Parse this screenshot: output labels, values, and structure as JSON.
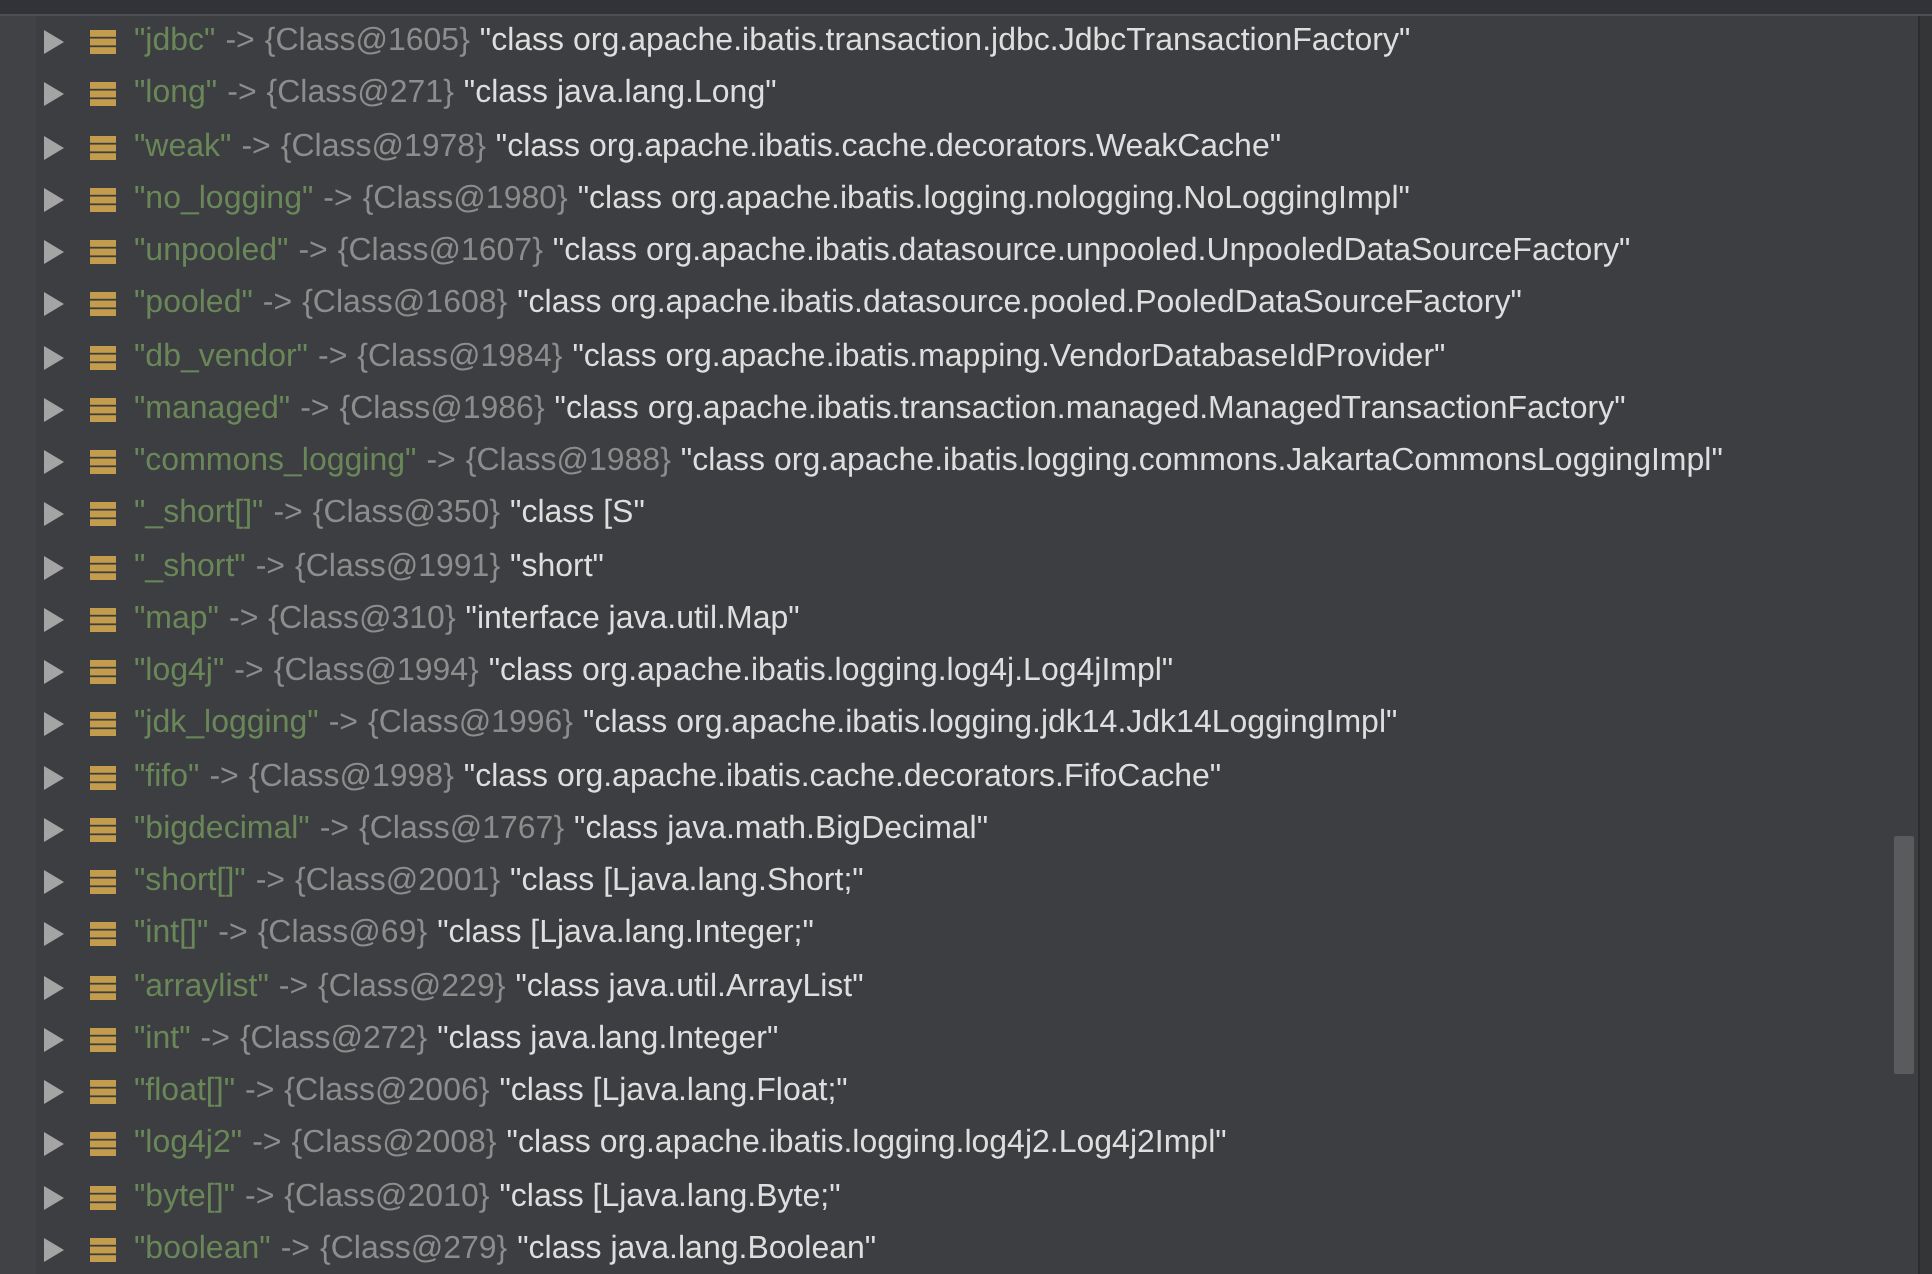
{
  "variables": [
    {
      "key": "\"jdbc\"",
      "arrow": "->",
      "ref": "{Class@1605}",
      "value": "\"class org.apache.ibatis.transaction.jdbc.JdbcTransactionFactory\"",
      "expanded": false
    },
    {
      "key": "\"long\"",
      "arrow": "->",
      "ref": "{Class@271}",
      "value": "\"class java.lang.Long\"",
      "expanded": false
    },
    {
      "key": "\"weak\"",
      "arrow": "->",
      "ref": "{Class@1978}",
      "value": "\"class org.apache.ibatis.cache.decorators.WeakCache\"",
      "expanded": false
    },
    {
      "key": "\"no_logging\"",
      "arrow": "->",
      "ref": "{Class@1980}",
      "value": "\"class org.apache.ibatis.logging.nologging.NoLoggingImpl\"",
      "expanded": false
    },
    {
      "key": "\"unpooled\"",
      "arrow": "->",
      "ref": "{Class@1607}",
      "value": "\"class org.apache.ibatis.datasource.unpooled.UnpooledDataSourceFactory\"",
      "expanded": false
    },
    {
      "key": "\"pooled\"",
      "arrow": "->",
      "ref": "{Class@1608}",
      "value": "\"class org.apache.ibatis.datasource.pooled.PooledDataSourceFactory\"",
      "expanded": false
    },
    {
      "key": "\"db_vendor\"",
      "arrow": "->",
      "ref": "{Class@1984}",
      "value": "\"class org.apache.ibatis.mapping.VendorDatabaseIdProvider\"",
      "expanded": false
    },
    {
      "key": "\"managed\"",
      "arrow": "->",
      "ref": "{Class@1986}",
      "value": "\"class org.apache.ibatis.transaction.managed.ManagedTransactionFactory\"",
      "expanded": false
    },
    {
      "key": "\"commons_logging\"",
      "arrow": "->",
      "ref": "{Class@1988}",
      "value": "\"class org.apache.ibatis.logging.commons.JakartaCommonsLoggingImpl\"",
      "expanded": false
    },
    {
      "key": "\"_short[]\"",
      "arrow": "->",
      "ref": "{Class@350}",
      "value": "\"class [S\"",
      "expanded": false
    },
    {
      "key": "\"_short\"",
      "arrow": "->",
      "ref": "{Class@1991}",
      "value": "\"short\"",
      "expanded": false
    },
    {
      "key": "\"map\"",
      "arrow": "->",
      "ref": "{Class@310}",
      "value": "\"interface java.util.Map\"",
      "expanded": false
    },
    {
      "key": "\"log4j\"",
      "arrow": "->",
      "ref": "{Class@1994}",
      "value": "\"class org.apache.ibatis.logging.log4j.Log4jImpl\"",
      "expanded": false
    },
    {
      "key": "\"jdk_logging\"",
      "arrow": "->",
      "ref": "{Class@1996}",
      "value": "\"class org.apache.ibatis.logging.jdk14.Jdk14LoggingImpl\"",
      "expanded": false
    },
    {
      "key": "\"fifo\"",
      "arrow": "->",
      "ref": "{Class@1998}",
      "value": "\"class org.apache.ibatis.cache.decorators.FifoCache\"",
      "expanded": false
    },
    {
      "key": "\"bigdecimal\"",
      "arrow": "->",
      "ref": "{Class@1767}",
      "value": "\"class java.math.BigDecimal\"",
      "expanded": false
    },
    {
      "key": "\"short[]\"",
      "arrow": "->",
      "ref": "{Class@2001}",
      "value": "\"class [Ljava.lang.Short;\"",
      "expanded": false
    },
    {
      "key": "\"int[]\"",
      "arrow": "->",
      "ref": "{Class@69}",
      "value": "\"class [Ljava.lang.Integer;\"",
      "expanded": false
    },
    {
      "key": "\"arraylist\"",
      "arrow": "->",
      "ref": "{Class@229}",
      "value": "\"class java.util.ArrayList\"",
      "expanded": false
    },
    {
      "key": "\"int\"",
      "arrow": "->",
      "ref": "{Class@272}",
      "value": "\"class java.lang.Integer\"",
      "expanded": false
    },
    {
      "key": "\"float[]\"",
      "arrow": "->",
      "ref": "{Class@2006}",
      "value": "\"class [Ljava.lang.Float;\"",
      "expanded": false
    },
    {
      "key": "\"log4j2\"",
      "arrow": "->",
      "ref": "{Class@2008}",
      "value": "\"class org.apache.ibatis.logging.log4j2.Log4j2Impl\"",
      "expanded": false
    },
    {
      "key": "\"byte[]\"",
      "arrow": "->",
      "ref": "{Class@2010}",
      "value": "\"class [Ljava.lang.Byte;\"",
      "expanded": false
    },
    {
      "key": "\"boolean\"",
      "arrow": "->",
      "ref": "{Class@279}",
      "value": "\"class java.lang.Boolean\"",
      "expanded": false
    }
  ]
}
